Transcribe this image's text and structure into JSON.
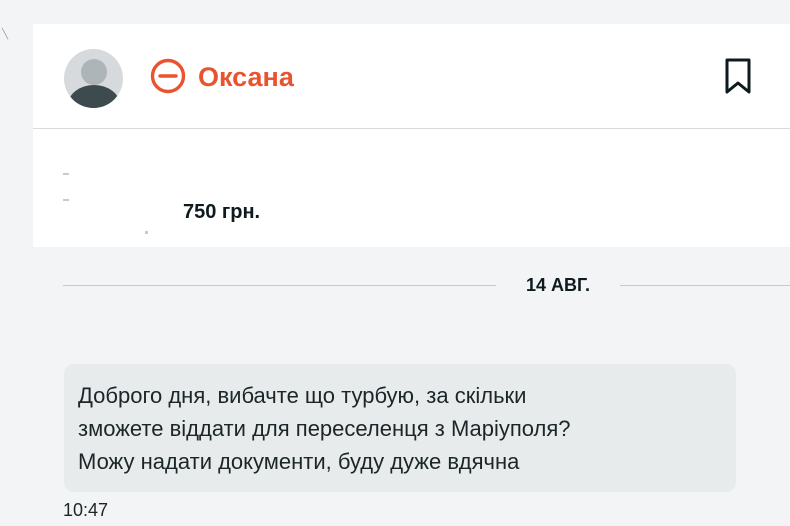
{
  "header": {
    "user_name": "Оксана",
    "blocked_icon": "minus-circle-icon",
    "bookmark_icon": "bookmark-icon"
  },
  "ad": {
    "price": "750 грн."
  },
  "conversation": {
    "date_label": "14 АВГ.",
    "messages": [
      {
        "text": "Доброго дня, вибачте що турбую, за скільки\nзможете віддати для переселенця з Маріуполя?\nМожу надати документи, буду дуже вдячна",
        "time": "10:47"
      }
    ]
  },
  "colors": {
    "accent": "#e9542f",
    "bubble": "#e8ebec",
    "background": "#f2f4f5"
  }
}
